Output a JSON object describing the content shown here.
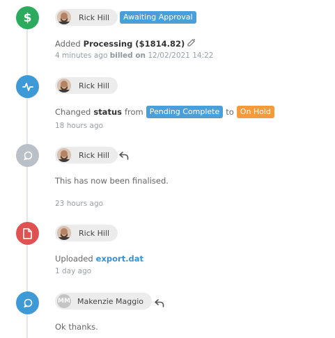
{
  "colors": {
    "green": "#2cab5e",
    "blue": "#3d9ad7",
    "gray": "#b9c0c7",
    "red": "#e05252",
    "badge_blue": "#4a9fd8",
    "badge_orange": "#f79a3b"
  },
  "events": [
    {
      "icon": "dollar-icon",
      "user": "Rick Hill",
      "badge": "Awaiting Approval",
      "action": "Added",
      "subject": "Processing ($1814.82)",
      "time": "4 minutes ago",
      "billed_label": "billed on",
      "billed_date": "12/02/2021 14:22"
    },
    {
      "icon": "activity-icon",
      "user": "Rick Hill",
      "action": "Changed",
      "subject": "status",
      "from_word": "from",
      "from_status": "Pending Complete",
      "to_word": "to",
      "to_status": "On Hold",
      "time": "18 hours ago"
    },
    {
      "icon": "comment-icon",
      "user": "Rick Hill",
      "text": "This has now been finalised.",
      "time": "23 hours ago"
    },
    {
      "icon": "file-icon",
      "user": "Rick Hill",
      "action": "Uploaded",
      "file": "export.dat",
      "time": "1 day ago"
    },
    {
      "icon": "comment-icon",
      "user": "Makenzie Maggio",
      "initials": "MM",
      "text": "Ok thanks."
    }
  ]
}
